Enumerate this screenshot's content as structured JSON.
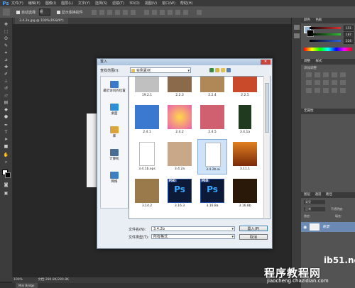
{
  "app": {
    "logo": "Ps",
    "menu": [
      "文件(F)",
      "编辑(E)",
      "图像(I)",
      "图层(L)",
      "文字(Y)",
      "选择(S)",
      "滤镜(T)",
      "3D(D)",
      "视图(V)",
      "窗口(W)",
      "帮助(H)"
    ]
  },
  "options": {
    "auto_select_label": "自动选择:",
    "auto_select_value": "组",
    "show_transform_label": "显示变换控件"
  },
  "document_tab": "3.4.2a.jpg @ 100%(RGB/8*)",
  "status": {
    "zoom": "100%",
    "doc_info": "文档:280.8K/280.8K"
  },
  "bottom_tab": "Mini Bridge",
  "panels": {
    "color_tab": "颜色",
    "swatches_tab": "色板",
    "adjust_tab": "调整",
    "adjust_hint": "添加调整",
    "styles_tab": "样式",
    "styles_hint": "无属性",
    "layers_tab": "图层",
    "channels_tab": "通道",
    "paths_tab": "路径",
    "kind_label": "类型",
    "mode_label": "正常",
    "opacity_label": "不透明度:",
    "lock_label": "锁定:",
    "fill_label": "填充:",
    "layer_name": "背景",
    "r_value": "151",
    "g_value": "187",
    "b_value": "224",
    "r_color": "#e03030",
    "g_color": "#30c030",
    "b_color": "#3060e0"
  },
  "dialog": {
    "title": "置入",
    "close_label": "✕",
    "look_in_label": "查找范围(I):",
    "look_in_value": "实例素材",
    "places": [
      {
        "label": "最近访问的位置",
        "icon": "recent-places-icon",
        "color": "#3a78c9"
      },
      {
        "label": "桌面",
        "icon": "desktop-icon",
        "color": "#2f8fd6"
      },
      {
        "label": "库",
        "icon": "libraries-icon",
        "color": "#d9a43c"
      },
      {
        "label": "计算机",
        "icon": "computer-icon",
        "color": "#4a6d93"
      },
      {
        "label": "网络",
        "icon": "network-icon",
        "color": "#3e7fc2"
      }
    ],
    "files": [
      {
        "name": "19.2.1",
        "kind": "image",
        "color": "#c0c0c0"
      },
      {
        "name": "2.2.3",
        "kind": "image",
        "color": "#8a6a4a"
      },
      {
        "name": "2.2.4",
        "kind": "image",
        "color": "#b08858"
      },
      {
        "name": "2.2.5",
        "kind": "image",
        "color": "#c94a2a"
      },
      {
        "name": "2.4.1",
        "kind": "image",
        "color": "#3b78d0"
      },
      {
        "name": "2.4.2",
        "kind": "image",
        "color": "#e85fae"
      },
      {
        "name": "2.4.5",
        "kind": "image",
        "color": "#d06070"
      },
      {
        "name": "3.4.1a",
        "kind": "image",
        "color": "#1f3a1f"
      },
      {
        "name": "3.4.1b.eps",
        "kind": "doc",
        "color": "#ffffff"
      },
      {
        "name": "3.4.2a",
        "kind": "image",
        "color": "#c9a88a"
      },
      {
        "name": "3.4.2b.ai",
        "kind": "doc",
        "color": "#ffffff"
      },
      {
        "name": "3.11.1",
        "kind": "image",
        "color": "#e08020"
      },
      {
        "name": "3.14.2",
        "kind": "image",
        "color": "#9a7a4a"
      },
      {
        "name": "3.16.3",
        "kind": "psd",
        "color": "#0c1a38"
      },
      {
        "name": "3.16.8a",
        "kind": "psd",
        "color": "#0c1a38"
      },
      {
        "name": "3.16.8b",
        "kind": "image",
        "color": "#2a1808"
      }
    ],
    "psd_badge": "PSD",
    "ps_glyph": "Ps",
    "filename_label": "文件名(N):",
    "filename_value": "3.4.2b",
    "filetype_label": "文件类型(T):",
    "filetype_value": "所有格式",
    "place_button": "置入(P)",
    "cancel_button": "取消"
  },
  "watermark": {
    "site": "ib51.net",
    "title": "程序教程网",
    "url": "jiaocheng.chazidian.com"
  }
}
